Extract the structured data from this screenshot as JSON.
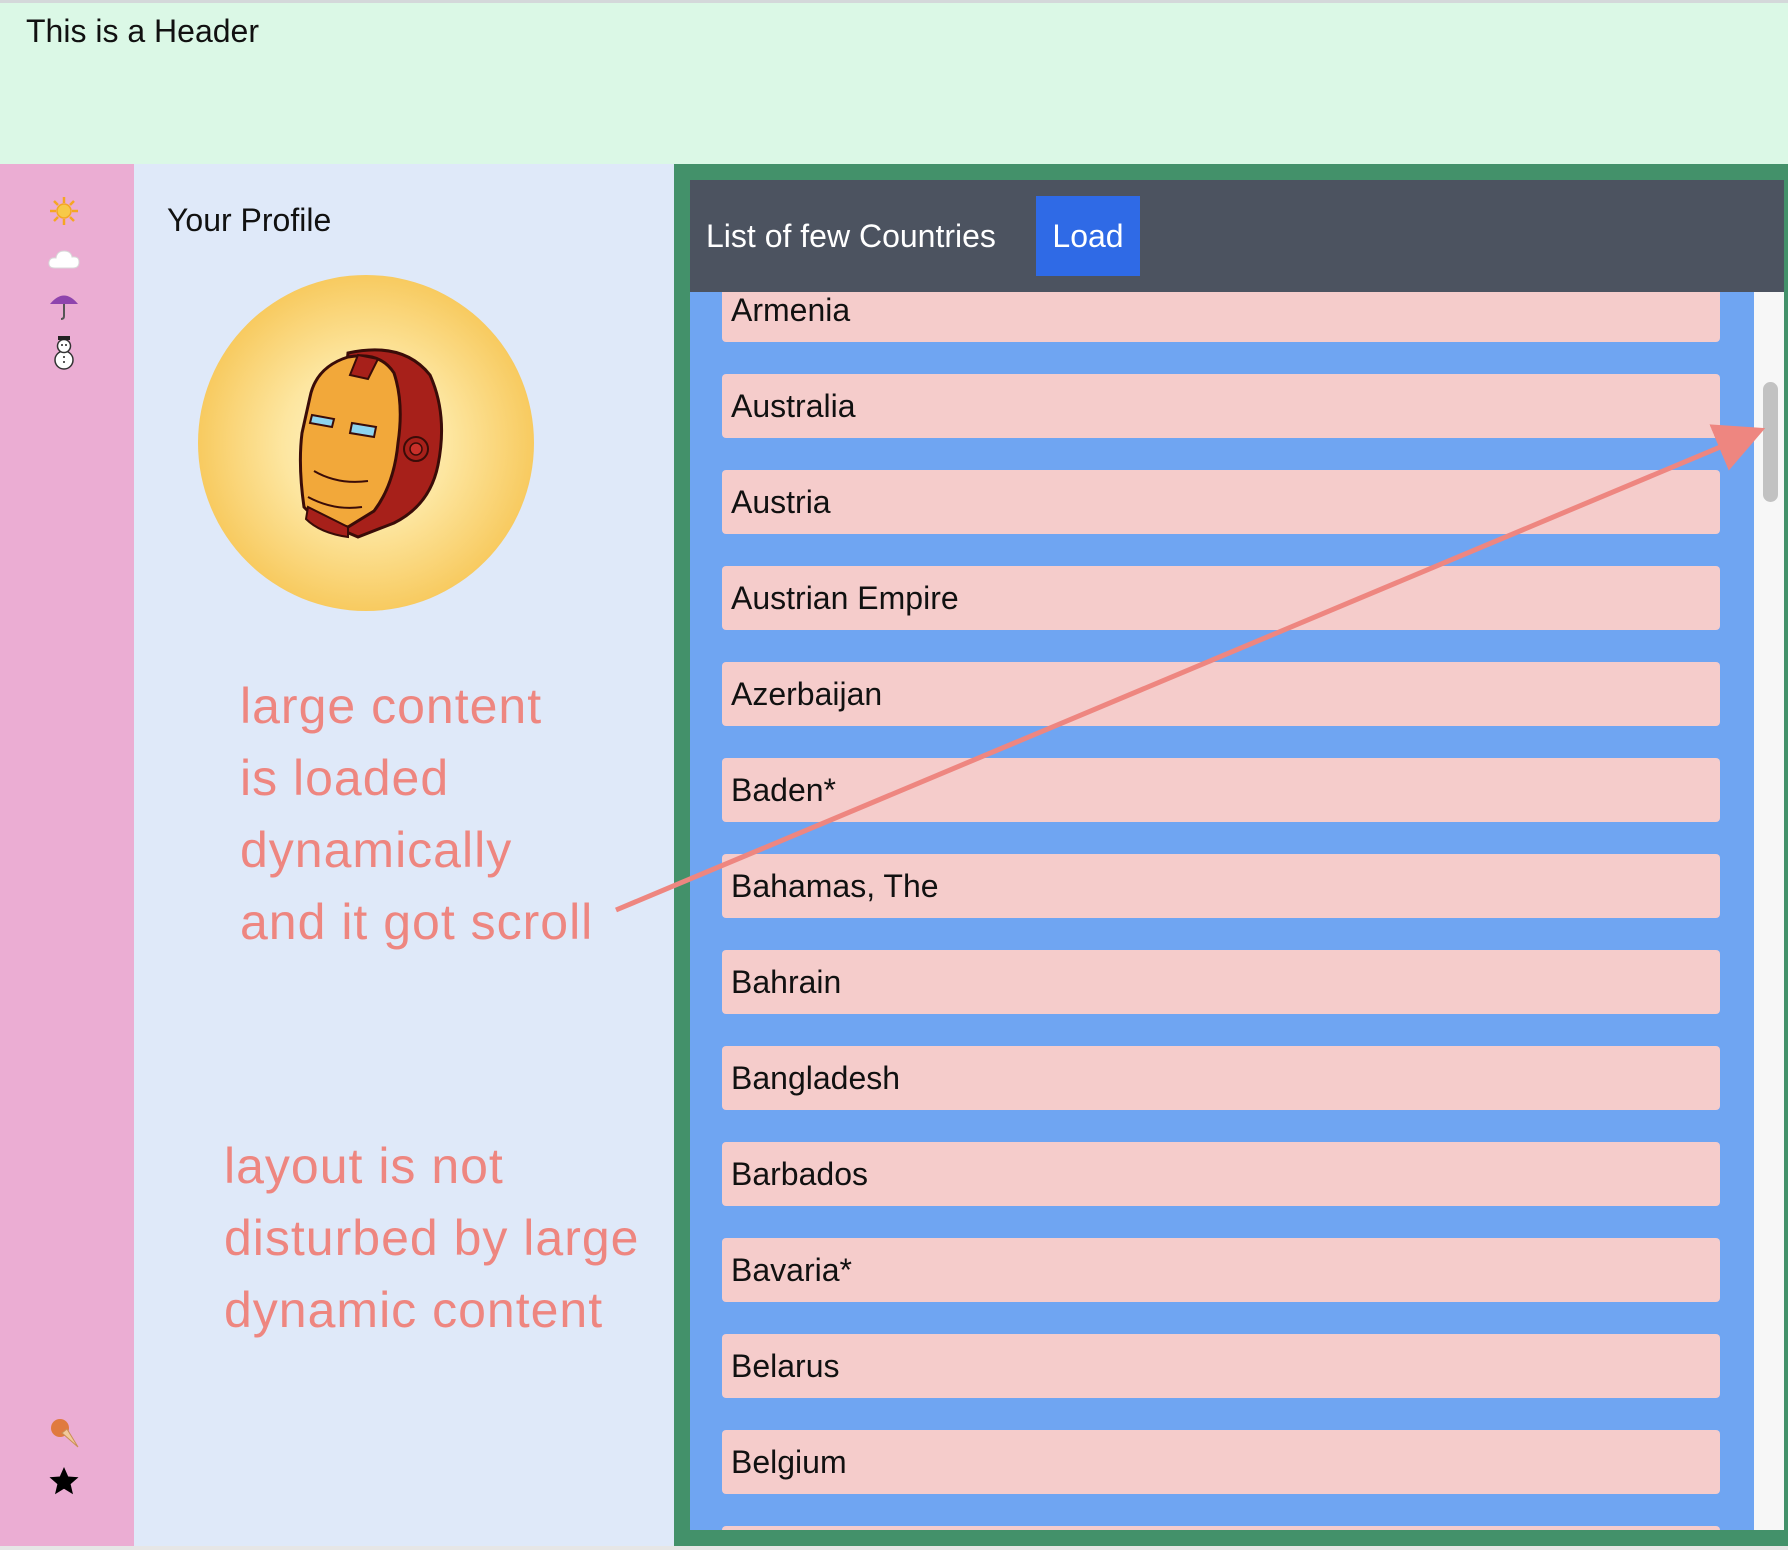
{
  "header": {
    "title": "This is a Header"
  },
  "rail": {
    "icons": [
      {
        "name": "sun-icon",
        "glyph": "☀",
        "color": "#f5a623"
      },
      {
        "name": "cloud-icon",
        "glyph": "☁",
        "color": "#ffffff"
      },
      {
        "name": "umbrella-icon",
        "glyph": "☂",
        "color": "#8e44ad"
      },
      {
        "name": "snowman-icon",
        "glyph": "☃",
        "color": "#333333"
      },
      {
        "name": "ice-cream-icon",
        "glyph": "🍦",
        "color": "#e07a3f"
      },
      {
        "name": "star-icon",
        "glyph": "★",
        "color": "#000000"
      }
    ]
  },
  "profile": {
    "title": "Your Profile",
    "avatar_icon": "iron-man-helmet-icon"
  },
  "annotations": {
    "note1": [
      "large content",
      "is loaded",
      "dynamically",
      "and it got scroll"
    ],
    "note2": [
      "layout is not",
      "disturbed by large",
      "dynamic content"
    ],
    "color": "#ee8680"
  },
  "panel": {
    "title": "List of few Countries",
    "load_label": "Load",
    "countries": [
      "Armenia",
      "Australia",
      "Austria",
      "Austrian Empire",
      "Azerbaijan",
      "Baden*",
      "Bahamas, The",
      "Bahrain",
      "Bangladesh",
      "Barbados",
      "Bavaria*",
      "Belarus",
      "Belgium"
    ]
  },
  "colors": {
    "header_bg": "#dbf8e6",
    "rail_bg": "#ebadd3",
    "profile_bg": "#dfe9f9",
    "panel_border": "#43916a",
    "list_bg": "#6fa5f2",
    "toolbar_bg": "#4c5360",
    "button_bg": "#2f6ae6",
    "item_bg": "#f5cccb"
  }
}
